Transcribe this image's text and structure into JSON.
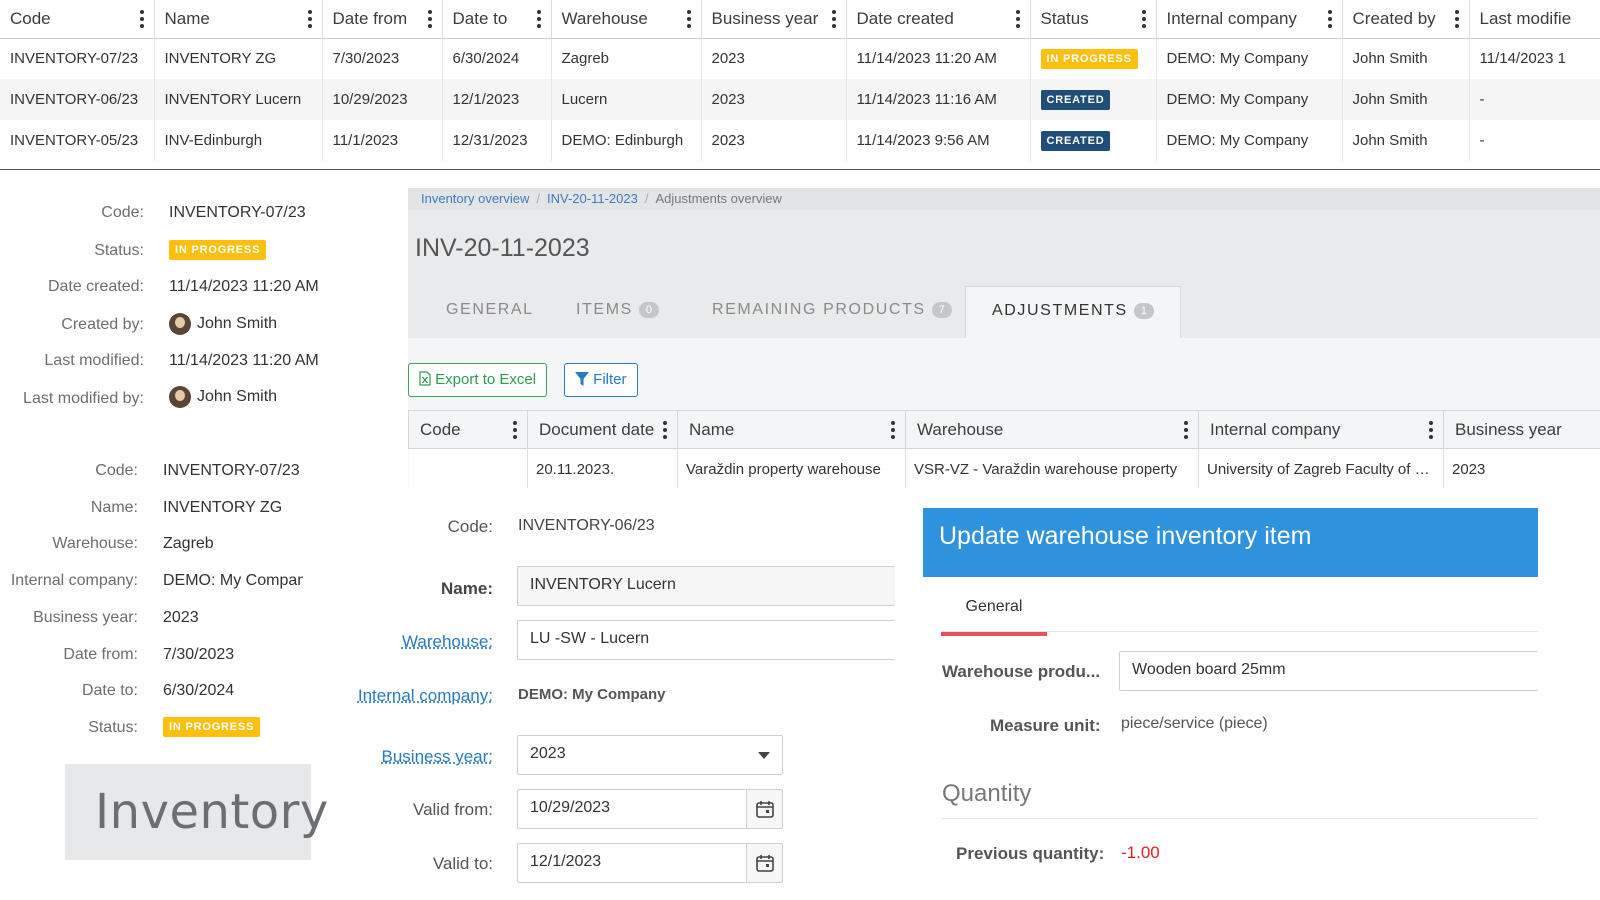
{
  "top_grid": {
    "columns": [
      "Code",
      "Name",
      "Date from",
      "Date to",
      "Warehouse",
      "Business year",
      "Date created",
      "Status",
      "Internal company",
      "Created by",
      "Last modifie"
    ],
    "rows": [
      {
        "code": "INVENTORY-07/23",
        "name": "INVENTORY ZG",
        "date_from": "7/30/2023",
        "date_to": "6/30/2024",
        "warehouse": "Zagreb",
        "year": "2023",
        "created": "11/14/2023 11:20 AM",
        "status": "IN PROGRESS",
        "company": "DEMO: My Company",
        "created_by": "John Smith",
        "last_modified": "11/14/2023 1"
      },
      {
        "code": "INVENTORY-06/23",
        "name": "INVENTORY Lucern",
        "date_from": "10/29/2023",
        "date_to": "12/1/2023",
        "warehouse": "Lucern",
        "year": "2023",
        "created": "11/14/2023 11:16 AM",
        "status": "CREATED",
        "company": "DEMO: My Company",
        "created_by": "John Smith",
        "last_modified": "-"
      },
      {
        "code": "INVENTORY-05/23",
        "name": "INV-Edinburgh",
        "date_from": "11/1/2023",
        "date_to": "12/31/2023",
        "warehouse": "DEMO: Edinburgh",
        "year": "2023",
        "created": "11/14/2023 9:56 AM",
        "status": "CREATED",
        "company": "DEMO: My Company",
        "created_by": "John Smith",
        "last_modified": "-"
      }
    ]
  },
  "summary": {
    "code_label": "Code:",
    "code": "INVENTORY-07/23",
    "status_label": "Status:",
    "status": "IN PROGRESS",
    "date_created_label": "Date created:",
    "date_created": "11/14/2023 11:20 AM",
    "created_by_label": "Created by:",
    "created_by": "John Smith",
    "last_modified_label": "Last modified:",
    "last_modified": "11/14/2023 11:20 AM",
    "last_modified_by_label": "Last modified by:",
    "last_modified_by": "John Smith"
  },
  "details": {
    "code_label": "Code:",
    "code": "INVENTORY-07/23",
    "name_label": "Name:",
    "name": "INVENTORY ZG",
    "warehouse_label": "Warehouse:",
    "warehouse": "Zagreb",
    "company_label": "Internal company:",
    "company": "DEMO: My Compan",
    "year_label": "Business year:",
    "year": "2023",
    "date_from_label": "Date from:",
    "date_from": "7/30/2023",
    "date_to_label": "Date to:",
    "date_to": "6/30/2024",
    "status_label": "Status:",
    "status": "IN PROGRESS"
  },
  "logo_text": "Inventory",
  "inventory_panel": {
    "breadcrumb": [
      "Inventory overview",
      "INV-20-11-2023",
      "Adjustments overview"
    ],
    "title": "INV-20-11-2023",
    "tabs": [
      {
        "label": "GENERAL",
        "count": null
      },
      {
        "label": "ITEMS",
        "count": "0"
      },
      {
        "label": "REMAINING PRODUCTS",
        "count": "7"
      },
      {
        "label": "ADJUSTMENTS",
        "count": "1"
      }
    ],
    "export_label": "Export to Excel",
    "filter_label": "Filter",
    "grid_columns": [
      "Code",
      "Document date",
      "Name",
      "Warehouse",
      "Internal company",
      "Business year"
    ],
    "grid_row": {
      "code": "",
      "date": "20.11.2023.",
      "name": "Varaždin property warehouse",
      "warehouse": "VSR-VZ - Varaždin warehouse property",
      "company": "University of Zagreb Faculty of Ci...",
      "year": "2023"
    }
  },
  "edit_form": {
    "code_label": "Code:",
    "code": "INVENTORY-06/23",
    "name_label": "Name:",
    "name": "INVENTORY Lucern",
    "warehouse_label": "Warehouse:",
    "warehouse": "LU -SW - Lucern",
    "company_label": "Internal company:",
    "company": "DEMO: My Company",
    "year_label": "Business year:",
    "year": "2023",
    "valid_from_label": "Valid from:",
    "valid_from": "10/29/2023",
    "valid_to_label": "Valid to:",
    "valid_to": "12/1/2023"
  },
  "dialog": {
    "title": "Update warehouse inventory item",
    "tab": "General",
    "product_label": "Warehouse produ...",
    "product": "Wooden board 25mm",
    "unit_label": "Measure unit:",
    "unit": "piece/service (piece)",
    "quantity_title": "Quantity",
    "prev_qty_label": "Previous quantity:",
    "prev_qty": "-1.00"
  },
  "colors": {
    "accent": "#2f92dd",
    "progress": "#fdc00f",
    "created": "#1f4e79",
    "negative": "#e02020",
    "tab_underline": "#e8505b"
  }
}
